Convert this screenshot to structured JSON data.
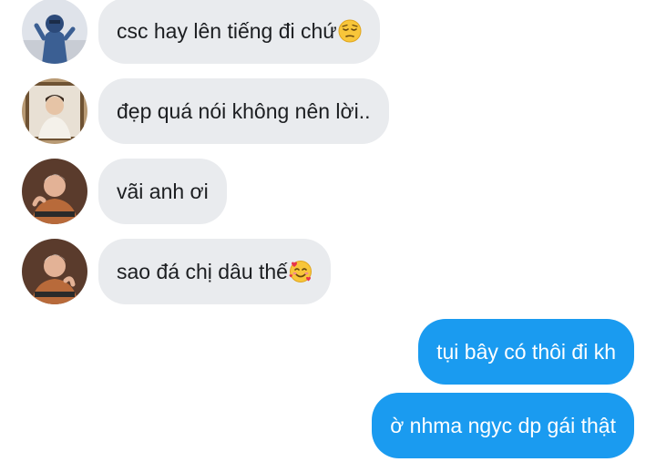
{
  "messages": [
    {
      "direction": "incoming",
      "avatar": "avatar-user-1",
      "text": "csc hay lên tiếng đi chứ",
      "emoji": "pensive-face-icon"
    },
    {
      "direction": "incoming",
      "avatar": "avatar-user-2",
      "text": "đẹp quá nói không nên lời..",
      "emoji": ""
    },
    {
      "direction": "incoming",
      "avatar": "avatar-user-3",
      "text": "vãi anh ơi",
      "emoji": ""
    },
    {
      "direction": "incoming",
      "avatar": "avatar-user-3",
      "text": "sao đá chị dâu thế",
      "emoji": "smiling-face-with-hearts-icon"
    },
    {
      "direction": "outgoing",
      "text": "tụi bây có thôi đi kh"
    },
    {
      "direction": "outgoing",
      "text": "ờ nhma ngyc dp gái thật"
    }
  ],
  "colors": {
    "incoming_bubble": "#e9ebee",
    "outgoing_bubble": "#1a9bf0",
    "incoming_text": "#1c1e21",
    "outgoing_text": "#ffffff"
  }
}
